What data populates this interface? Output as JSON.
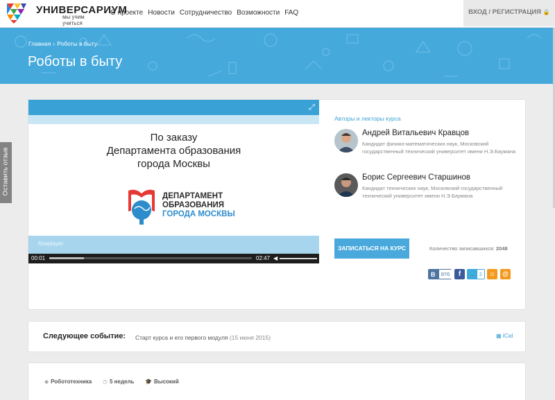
{
  "header": {
    "logo_text": "УНИВЕРСАРИУМ",
    "logo_sub": "мы учим учиться",
    "nav": [
      "О проекте",
      "Новости",
      "Сотрудничество",
      "Возможности",
      "FAQ"
    ],
    "login_label": "ВХОД / РЕГИСТРАЦИЯ"
  },
  "banner": {
    "breadcrumb": [
      "Главная",
      "Роботы в быту"
    ],
    "title": "Роботы в быту",
    "color": "#45a9dc"
  },
  "video": {
    "line1": "По заказу",
    "line2": "Департамента образования",
    "line3": "города Москвы",
    "dept1": "ДЕПАРТАМЕНТ",
    "dept2": "ОБРАЗОВАНИЯ",
    "dept3": "ГОРОДА МОСКВЫ",
    "watermark": "flowplayer",
    "time_current": "00:01",
    "time_total": "02:47",
    "progress": 0.17
  },
  "authors": {
    "title": "Авторы и лекторы курса",
    "items": [
      {
        "name": "Андрей Витальевич Кравцов",
        "desc": "Кандидат физико-математических наук, Московский государственный технический университет имени Н.Э.Баумана"
      },
      {
        "name": "Борис Сергеевич Старшинов",
        "desc": "Кандидат технических наук, Московский государственный технический университет имени Н.Э.Баумана"
      }
    ]
  },
  "enroll": {
    "button": "ЗАПИСАТЬСЯ НА КУРС",
    "count_label": "Количество записавшихся:",
    "count_value": "2048"
  },
  "share": {
    "vk_label": "В",
    "vk_count": "876",
    "fb_label": "f",
    "tw_count": "2"
  },
  "event": {
    "label": "Следующее событие:",
    "text": "Старт курса и его первого модуля",
    "date": "(15 июня 2015)",
    "ical": "iCal"
  },
  "info": {
    "tags": [
      "Робототехника",
      "5 недель",
      "Высокий"
    ]
  },
  "feedback": "Оставить отзыв"
}
